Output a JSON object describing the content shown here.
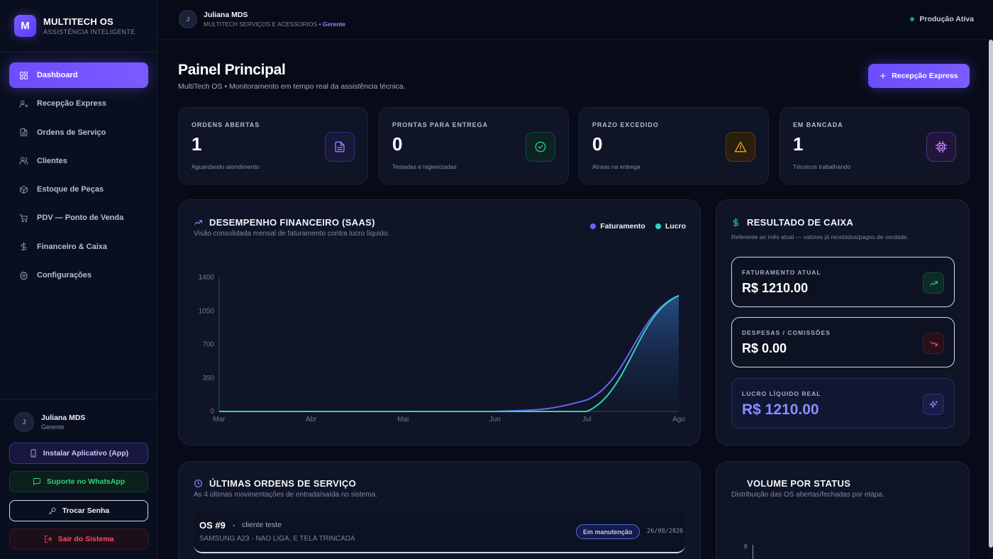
{
  "brand": {
    "name": "MULTITECH OS",
    "tagline": "ASSISTÊNCIA INTELIGENTE",
    "logo_letter": "M"
  },
  "sidebar": {
    "items": [
      {
        "label": "Dashboard",
        "icon": "grid-icon",
        "active": true
      },
      {
        "label": "Recepção Express",
        "icon": "user-plus-icon"
      },
      {
        "label": "Ordens de Serviço",
        "icon": "document-icon"
      },
      {
        "label": "Clientes",
        "icon": "users-icon"
      },
      {
        "label": "Estoque de Peças",
        "icon": "package-icon"
      },
      {
        "label": "PDV — Ponto de Venda",
        "icon": "cart-icon"
      },
      {
        "label": "Financeiro & Caixa",
        "icon": "dollar-icon"
      },
      {
        "label": "Configurações",
        "icon": "gear-icon"
      }
    ],
    "user": {
      "initial": "J",
      "name": "Juliana MDS",
      "role": "Gerente"
    },
    "buttons": {
      "install": "Instalar Aplicativo (App)",
      "whatsapp": "Suporte no WhatsApp",
      "password": "Trocar Senha",
      "logout": "Sair do Sistema"
    }
  },
  "topbar": {
    "user_initial": "J",
    "user_name": "Juliana MDS",
    "company": "MULTITECH SERVIÇOS E ACESSORIOS",
    "role_separator": " • ",
    "role": "Gerente",
    "status": "Produção Ativa",
    "status_color": "#1f9d6a"
  },
  "page": {
    "title": "Painel Principal",
    "subtitle": "MultiTech OS • Monitoramento em tempo real da assistência técnica.",
    "primary_button": "Recepção Express",
    "primary_button_icon": "+"
  },
  "stats": [
    {
      "label": "ORDENS ABERTAS",
      "value": "1",
      "desc": "Aguardando atendimento",
      "icon": "document-icon",
      "color": "#8f92ff"
    },
    {
      "label": "PRONTAS PARA ENTREGA",
      "value": "0",
      "desc": "Testadas e higienizadas",
      "icon": "check-circle-icon",
      "color": "#2fd48c"
    },
    {
      "label": "PRAZO EXCEDIDO",
      "value": "0",
      "desc": "Atraso na entrega",
      "icon": "warning-icon",
      "color": "#ffb020"
    },
    {
      "label": "EM BANCADA",
      "value": "1",
      "desc": "Técnicos trabalhando",
      "icon": "chip-icon",
      "color": "#c28bff"
    }
  ],
  "finance": {
    "title": "DESEMPENHO FINANCEIRO (SAAS)",
    "subtitle": "Visão consolidada mensal de faturamento contra lucro líquido.",
    "legend": [
      {
        "name": "Faturamento",
        "color": "#6b63f5"
      },
      {
        "name": "Lucro",
        "color": "#2fd4c0"
      }
    ]
  },
  "chart_data": {
    "type": "area",
    "title": "DESEMPENHO FINANCEIRO (SAAS)",
    "categories": [
      "Mar",
      "Abr",
      "Mai",
      "Jun",
      "Jul",
      "Ago"
    ],
    "series": [
      {
        "name": "Faturamento",
        "values": [
          0,
          0,
          0,
          0,
          120,
          1210
        ],
        "color": "#6b63f5"
      },
      {
        "name": "Lucro",
        "values": [
          0,
          0,
          0,
          0,
          0,
          1210
        ],
        "color": "#2fd4c0"
      }
    ],
    "yticks": [
      0,
      350,
      700,
      1050,
      1400
    ],
    "ylim": [
      0,
      1400
    ],
    "grid": false,
    "legend_position": "top-right"
  },
  "cash": {
    "title": "RESULTADO DE CAIXA",
    "subtitle": "Referente ao mês atual — valores já recebidos/pagos de verdade.",
    "cards": [
      {
        "label": "FATURAMENTO ATUAL",
        "value": "R$ 1210.00",
        "icon": "trend-up-icon"
      },
      {
        "label": "DESPESAS / COMISSÕES",
        "value": "R$ 0.00",
        "icon": "trend-down-icon"
      },
      {
        "label": "LUCRO LÍQUIDO REAL",
        "value": "R$ 1210.00",
        "icon": "sparkle-icon"
      }
    ]
  },
  "orders": {
    "title": "ÚLTIMAS ORDENS DE SERVIÇO",
    "subtitle": "As 4 últimas movimentações de entrada/saída no sistema.",
    "rows": [
      {
        "number": "OS #9",
        "separator": "•",
        "client": "cliente teste",
        "device": "SAMSUNG A23 - NAO LIGA, E TELA TRINCADA",
        "status": "Em manutenção",
        "date": "26/08/2026"
      }
    ]
  },
  "volume": {
    "title": "VOLUME POR STATUS",
    "subtitle": "Distribuição das OS abertas/fechadas por etapa.",
    "y_tick": "8"
  }
}
